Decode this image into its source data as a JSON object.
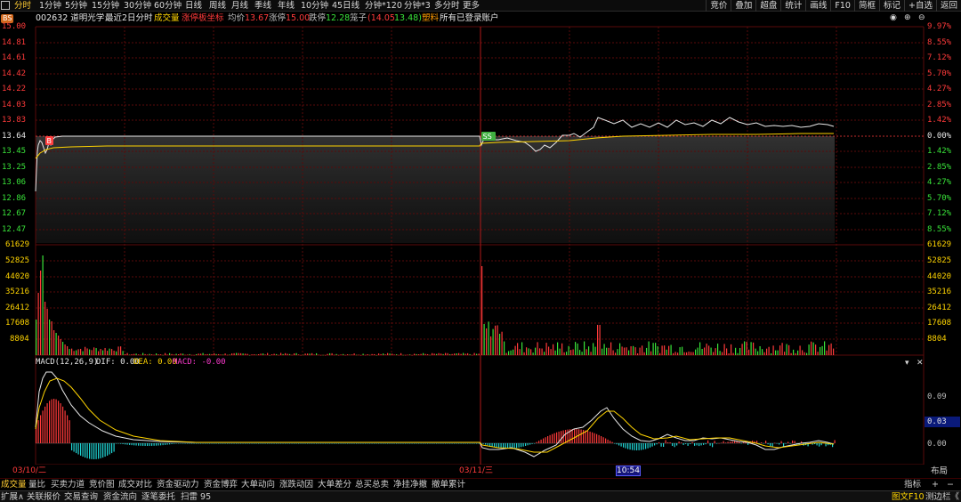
{
  "toolbar": {
    "periods": [
      "分时",
      "1分钟",
      "5分钟",
      "15分钟",
      "30分钟",
      "60分钟",
      "日线",
      "周线",
      "月线",
      "季线",
      "年线",
      "10分钟",
      "45日线",
      "分钟*120",
      "分钟*3",
      "多分时",
      "更多"
    ],
    "right": [
      "竞价",
      "叠加",
      "超盘",
      "统计",
      "画线",
      "F10",
      "简框",
      "标记",
      "+自选",
      "返回"
    ]
  },
  "info": {
    "code_name": "002632 道明光学",
    "mode": "最近2日分时",
    "volume": "成交量",
    "limit_axis": "涨停板坐标",
    "avg_label": "均价",
    "avg": "13.67",
    "up_label": "涨停",
    "up": "15.00",
    "down_label": "跌停",
    "down": "12.28",
    "box_label": "笼子",
    "box": "(14.05",
    "box_low": "13.48)",
    "tag": "塑料",
    "account": "所有已登录账户"
  },
  "price_axis": {
    "left": [
      "15.00",
      "14.81",
      "14.61",
      "14.42",
      "14.22",
      "14.03",
      "13.83",
      "13.64",
      "13.45",
      "13.25",
      "13.06",
      "12.86",
      "12.67",
      "12.47"
    ],
    "right": [
      "9.97%",
      "8.55%",
      "7.12%",
      "5.70%",
      "4.27%",
      "2.85%",
      "1.42%",
      "0.00%",
      "1.42%",
      "2.85%",
      "4.27%",
      "5.70%",
      "7.12%",
      "8.55%"
    ]
  },
  "volume_axis": [
    "61629",
    "52825",
    "44020",
    "35216",
    "26412",
    "17608",
    "8804"
  ],
  "macd": {
    "title": "MACD(12,26,9)",
    "dif": "DIF: 0.00",
    "dea": "DEA: 0.00",
    "macd": "MACD: -0.00",
    "axis": [
      "0.09",
      "0.03",
      "0.00"
    ]
  },
  "markers": {
    "b": "B",
    "ss": "SS"
  },
  "dates": {
    "d1": "03/10/二",
    "d2": "03/11/三",
    "cursor_time": "10:54"
  },
  "layout_btn": "布局",
  "indicator_btn": "指标",
  "tabs": [
    "成交量",
    "量比",
    "买卖力道",
    "竞价图",
    "成交对比",
    "资金驱动力",
    "资金博弈",
    "大单动向",
    "涨跌动因",
    "大单差分",
    "总买总卖",
    "净挂净撤",
    "撤单累计"
  ],
  "footer": {
    "left": [
      "扩展∧",
      "关联报价",
      "交易查询",
      "资金流向",
      "逐笔委托",
      "扫雷 95"
    ],
    "right": [
      "图文F10",
      "测边栏《"
    ]
  },
  "chart_data": {
    "type": "line",
    "x": [
      "03/10",
      "03/11"
    ],
    "series": [],
    "price_ylim": [
      12.28,
      15.0
    ],
    "prev_close": 13.64,
    "volume_ylim": [
      0,
      61629
    ],
    "macd_values_shown": [
      "0.09",
      "0.03",
      "0.00"
    ]
  }
}
